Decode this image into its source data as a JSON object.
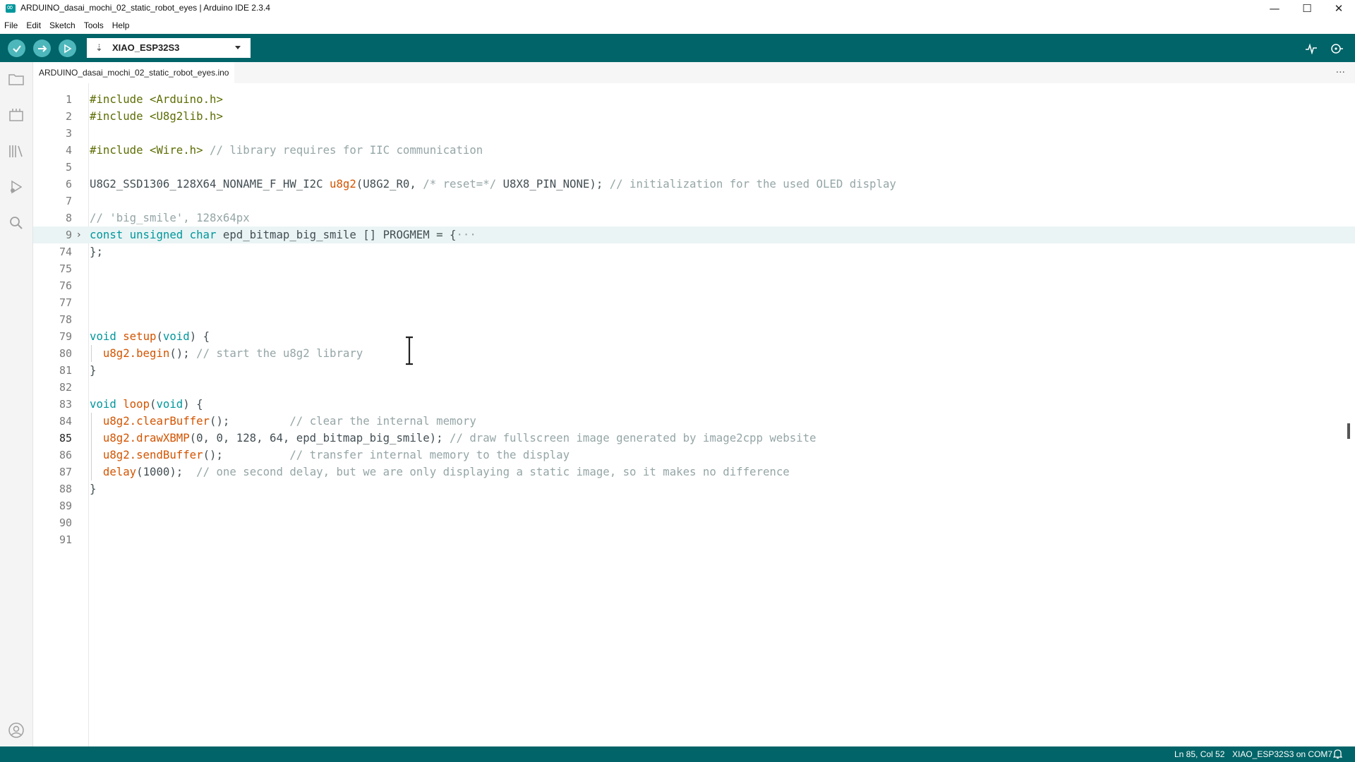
{
  "window": {
    "title": "ARDUINO_dasai_mochi_02_static_robot_eyes | Arduino IDE 2.3.4",
    "controls": {
      "minimize": "—",
      "maximize": "☐",
      "close": "✕"
    }
  },
  "menu": [
    "File",
    "Edit",
    "Sketch",
    "Tools",
    "Help"
  ],
  "toolbar": {
    "verify_icon": "check-icon",
    "upload_icon": "arrow-right-icon",
    "debug_icon": "debug-icon",
    "board": "XIAO_ESP32S3",
    "serial_plotter_icon": "pulse-icon",
    "serial_monitor_icon": "serial-monitor-icon"
  },
  "sidebar": [
    "folder-icon",
    "board-manager-icon",
    "library-icon",
    "debug-icon",
    "search-icon",
    "account-icon"
  ],
  "tab": {
    "filename": "ARDUINO_dasai_mochi_02_static_robot_eyes.ino",
    "more": "···"
  },
  "editor": {
    "current_line": 85,
    "lines": [
      {
        "n": "1",
        "tokens": [
          {
            "t": "#include ",
            "c": "pp"
          },
          {
            "t": "<Arduino.h>",
            "c": "pp"
          }
        ]
      },
      {
        "n": "2",
        "tokens": [
          {
            "t": "#include ",
            "c": "pp"
          },
          {
            "t": "<U8g2lib.h>",
            "c": "pp"
          }
        ]
      },
      {
        "n": "3",
        "tokens": []
      },
      {
        "n": "4",
        "tokens": [
          {
            "t": "#include ",
            "c": "pp"
          },
          {
            "t": "<Wire.h>",
            "c": "pp"
          },
          {
            "t": " // library requires for IIC communication",
            "c": "cm"
          }
        ]
      },
      {
        "n": "5",
        "tokens": []
      },
      {
        "n": "6",
        "tokens": [
          {
            "t": "U8G2_SSD1306_128X64_NONAME_F_HW_I2C ",
            "c": ""
          },
          {
            "t": "u8g2",
            "c": "fn"
          },
          {
            "t": "(U8G2_R0, ",
            "c": ""
          },
          {
            "t": "/* reset=*/",
            "c": "cm"
          },
          {
            "t": " U8X8_PIN_NONE); ",
            "c": ""
          },
          {
            "t": "// initialization for the used OLED display",
            "c": "cm"
          }
        ]
      },
      {
        "n": "7",
        "tokens": []
      },
      {
        "n": "8",
        "tokens": [
          {
            "t": "// 'big_smile', 128x64px",
            "c": "cm"
          }
        ]
      },
      {
        "n": "9",
        "fold": true,
        "tokens": [
          {
            "t": "const unsigned char",
            "c": "kw"
          },
          {
            "t": " epd_bitmap_big_smile [] PROGMEM = {",
            "c": ""
          },
          {
            "t": "···",
            "c": "cm"
          }
        ]
      },
      {
        "n": "74",
        "tokens": [
          {
            "t": "};",
            "c": ""
          }
        ]
      },
      {
        "n": "75",
        "tokens": []
      },
      {
        "n": "76",
        "tokens": []
      },
      {
        "n": "77",
        "tokens": []
      },
      {
        "n": "78",
        "tokens": []
      },
      {
        "n": "79",
        "tokens": [
          {
            "t": "void",
            "c": "kw"
          },
          {
            "t": " ",
            "c": ""
          },
          {
            "t": "setup",
            "c": "fn"
          },
          {
            "t": "(",
            "c": ""
          },
          {
            "t": "void",
            "c": "kw"
          },
          {
            "t": ") {",
            "c": ""
          }
        ]
      },
      {
        "n": "80",
        "guide": true,
        "tokens": [
          {
            "t": "  ",
            "c": ""
          },
          {
            "t": "u8g2.begin",
            "c": "fn"
          },
          {
            "t": "(); ",
            "c": ""
          },
          {
            "t": "// start the u8g2 library",
            "c": "cm"
          }
        ]
      },
      {
        "n": "81",
        "tokens": [
          {
            "t": "}",
            "c": ""
          }
        ]
      },
      {
        "n": "82",
        "tokens": []
      },
      {
        "n": "83",
        "tokens": [
          {
            "t": "void",
            "c": "kw"
          },
          {
            "t": " ",
            "c": ""
          },
          {
            "t": "loop",
            "c": "fn"
          },
          {
            "t": "(",
            "c": ""
          },
          {
            "t": "void",
            "c": "kw"
          },
          {
            "t": ") {",
            "c": ""
          }
        ]
      },
      {
        "n": "84",
        "guide": true,
        "tokens": [
          {
            "t": "  ",
            "c": ""
          },
          {
            "t": "u8g2.clearBuffer",
            "c": "fn"
          },
          {
            "t": "();         ",
            "c": ""
          },
          {
            "t": "// clear the internal memory",
            "c": "cm"
          }
        ]
      },
      {
        "n": "85",
        "guide": true,
        "tokens": [
          {
            "t": "  ",
            "c": ""
          },
          {
            "t": "u8g2.drawXBMP",
            "c": "fn"
          },
          {
            "t": "(0, 0, 128, 64, epd_bitmap_big_smile); ",
            "c": ""
          },
          {
            "t": "// draw fullscreen image generated by image2cpp website",
            "c": "cm"
          }
        ]
      },
      {
        "n": "86",
        "guide": true,
        "tokens": [
          {
            "t": "  ",
            "c": ""
          },
          {
            "t": "u8g2.sendBuffer",
            "c": "fn"
          },
          {
            "t": "();          ",
            "c": ""
          },
          {
            "t": "// transfer internal memory to the display",
            "c": "cm"
          }
        ]
      },
      {
        "n": "87",
        "guide": true,
        "tokens": [
          {
            "t": "  ",
            "c": ""
          },
          {
            "t": "delay",
            "c": "fn"
          },
          {
            "t": "(1000);  ",
            "c": ""
          },
          {
            "t": "// one second delay, but we are only displaying a static image, so it makes no difference",
            "c": "cm"
          }
        ]
      },
      {
        "n": "88",
        "tokens": [
          {
            "t": "}",
            "c": ""
          }
        ]
      },
      {
        "n": "89",
        "tokens": []
      },
      {
        "n": "90",
        "tokens": []
      },
      {
        "n": "91",
        "tokens": []
      }
    ]
  },
  "status": {
    "position": "Ln 85, Col 52",
    "board_port": "XIAO_ESP32S3 on COM7",
    "bell_icon": "bell-icon"
  },
  "colors": {
    "toolbar": "#006468",
    "accent": "#00979c",
    "button": "#4db7bb"
  }
}
